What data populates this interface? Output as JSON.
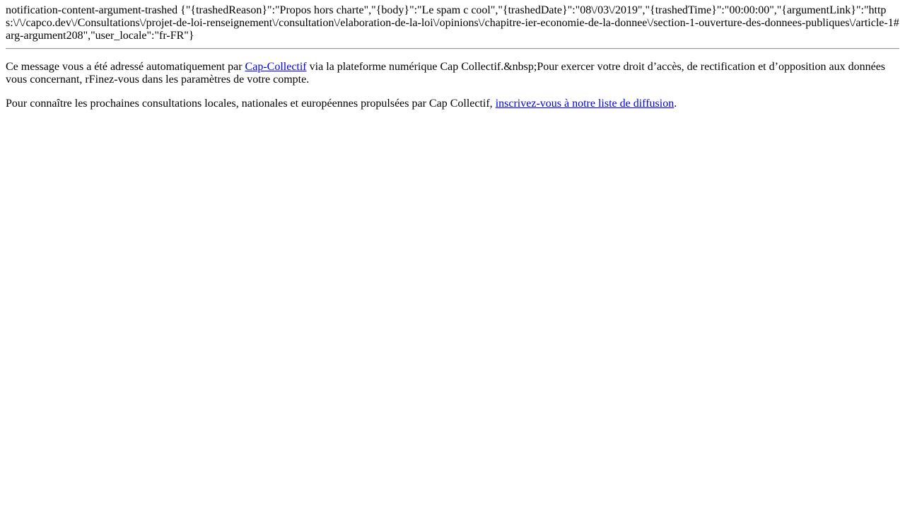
{
  "notification": {
    "raw_content": "notification-content-argument-trashed {\"{trashedReason}\":\"Propos hors charte\",\"{body}\":\"Le spam c cool\",\"{trashedDate}\":\"08\\/03\\/2019\",\"{trashedTime}\":\"00:00:00\",\"{argumentLink}\":\"https:\\/\\/capco.dev\\/Consultations\\/projet-de-loi-renseignement\\/consultation\\/elaboration-de-la-loi\\/opinions\\/chapitre-ier-economie-de-la-donnee\\/section-1-ouverture-des-donnees-publiques\\/article-1#arg-argument208\",\"user_locale\":\"fr-FR\"}"
  },
  "footer": {
    "auto_message": {
      "prefix": "Ce message vous a été adressé automatiquement par ",
      "link_label": "Cap-Collectif",
      "suffix": " via la plateforme numérique Cap Collectif.&nbsp;Pour exercer votre droit d’accès, de rectification et d’opposition aux données vous concernant, rFinez-vous dans les paramètres de votre compte."
    },
    "newsletter": {
      "prefix": "Pour connaître les prochaines consultations locales, nationales et européennes propulsées par Cap Collectif, ",
      "link_label": "inscrivez-vous à notre liste de diffusion",
      "suffix": "."
    }
  }
}
